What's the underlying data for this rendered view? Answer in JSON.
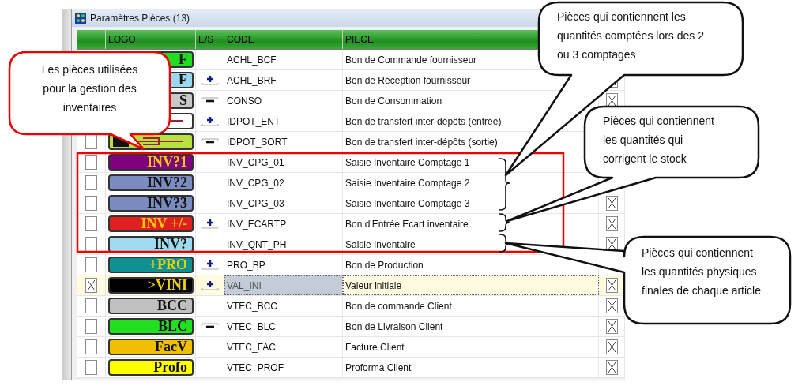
{
  "window": {
    "title": "Paramètres Pièces (13)"
  },
  "table": {
    "columns": [
      "LOGO",
      "E/S",
      "CODE",
      "PIECE"
    ],
    "rows": [
      {
        "selected": false,
        "logo": {
          "kind": "text",
          "text": "F",
          "color": "#22dd22"
        },
        "code": "ACHL_BCF",
        "piece": "Bon de Commande fournisseur"
      },
      {
        "selected": false,
        "logo": {
          "kind": "text",
          "text": "F",
          "color": "#9ad8f0"
        },
        "stock_in": true,
        "code": "ACHL_BRF",
        "piece": "Bon de Réception fournisseur",
        "flag_checked": true
      },
      {
        "selected": false,
        "logo": {
          "kind": "text",
          "text": "S",
          "color": "#c8c8c8"
        },
        "stock_in": false,
        "code": "CONSO",
        "piece": "Bon de Consommation",
        "flag_checked": true
      },
      {
        "selected": false,
        "logo": {
          "kind": "drawing",
          "color": "#ffffff"
        },
        "stock_in": true,
        "code": "IDPOT_ENT",
        "piece": "Bon de transfert inter-dépôts (entrée)"
      },
      {
        "selected": false,
        "checked": false,
        "logo": {
          "kind": "drawing",
          "color": "#b8e040"
        },
        "stock_in": false,
        "code": "IDPOT_SORT",
        "piece": "Bon de transfert inter-dépôts (sortie)"
      },
      {
        "selected": false,
        "checked": false,
        "logo": {
          "kind": "text",
          "text": "INV?1",
          "color": "#800080"
        },
        "code": "INV_CPG_01",
        "piece": "Saisie Inventaire Comptage 1"
      },
      {
        "selected": false,
        "checked": false,
        "logo": {
          "kind": "text",
          "text": "INV?2",
          "color": "#7a8cc0"
        },
        "code": "INV_CPG_02",
        "piece": "Saisie Inventaire Comptage 2"
      },
      {
        "selected": false,
        "checked": false,
        "logo": {
          "kind": "text",
          "text": "INV?3",
          "color": "#7a8cc0"
        },
        "code": "INV_CPG_03",
        "piece": "Saisie Inventaire Comptage 3",
        "flag_checked": true
      },
      {
        "selected": false,
        "checked": false,
        "logo": {
          "kind": "text",
          "text": "INV +/-",
          "color": "#e02020"
        },
        "stock_in": true,
        "code": "INV_ECARTP",
        "piece": "Bon d'Entrée Ecart inventaire",
        "flag_checked": true
      },
      {
        "selected": false,
        "checked": false,
        "logo": {
          "kind": "text",
          "text": "INV?",
          "color": "#a0dcf0"
        },
        "code": "INV_QNT_PH",
        "piece": "Saisie Inventaire",
        "flag_checked": true
      },
      {
        "selected": false,
        "checked": false,
        "logo": {
          "kind": "text",
          "text": "+PRO",
          "color": "#109090"
        },
        "stock_in": true,
        "code": "PRO_BP",
        "piece": "Bon de Production"
      },
      {
        "selected": true,
        "checked": true,
        "logo": {
          "kind": "text",
          "text": ">VINI",
          "color": "#000000"
        },
        "stock_in": true,
        "code": "VAL_INI",
        "piece": "Valeur initiale",
        "flag_checked": true
      },
      {
        "selected": false,
        "checked": false,
        "logo": {
          "kind": "text",
          "text": "BCC",
          "color": "#c0c0c0"
        },
        "code": "VTEC_BCC",
        "piece": "Bon de commande Client",
        "flag_checked": true
      },
      {
        "selected": false,
        "checked": false,
        "logo": {
          "kind": "text",
          "text": "BLC",
          "color": "#20e020"
        },
        "stock_in": false,
        "code": "VTEC_BLC",
        "piece": "Bon de Livraison Client",
        "flag_checked": true
      },
      {
        "selected": false,
        "checked": false,
        "logo": {
          "kind": "text",
          "text": "FacV",
          "color": "#f0c000"
        },
        "code": "VTEC_FAC",
        "piece": "Facture Client",
        "flag_checked": true
      },
      {
        "selected": false,
        "checked": false,
        "logo": {
          "kind": "text",
          "text": "Profo",
          "color": "#ffff00"
        },
        "code": "VTEC_PROF",
        "piece": "Proforma Client",
        "flag_checked": true
      }
    ]
  },
  "annotations": [
    {
      "text": "Les pièces utilisées\npour la gestion des\ninventaires"
    },
    {
      "text": "Pièces qui contiennent les\nquantités comptées lors des 2\nou 3 comptages"
    },
    {
      "text": "Pièces qui contiennent\nles quantités qui\ncorrigent le stock"
    },
    {
      "text": "Pièces qui contiennent\nles quantités physiques\nfinales de chaque article"
    }
  ]
}
